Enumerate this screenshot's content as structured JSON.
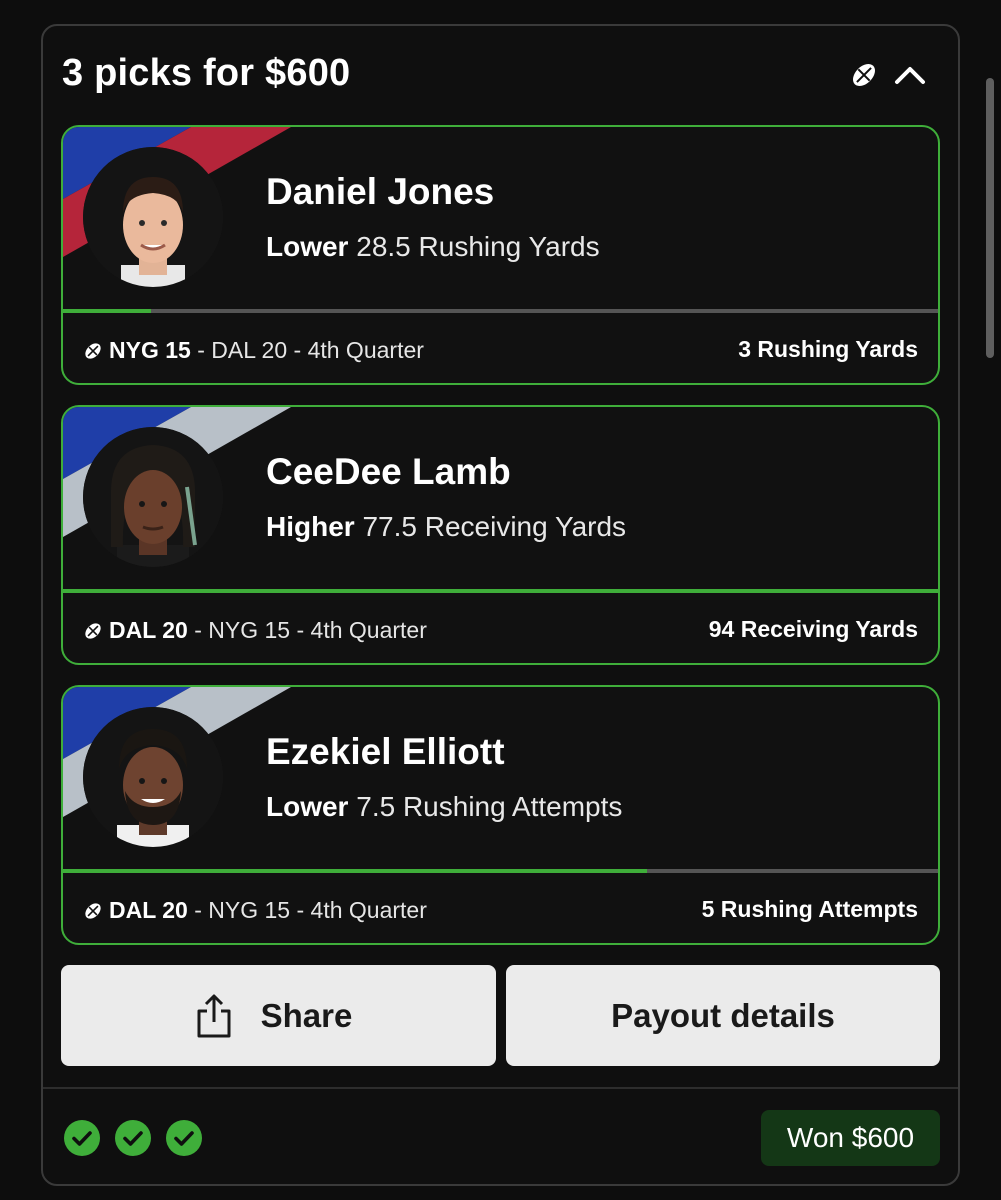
{
  "entry": {
    "title": "3 picks for $600"
  },
  "colors": {
    "accent_green": "#3fae3a",
    "badge_bg": "#143716",
    "stripe_blue": "#1f3ea8",
    "stripe_red": "#b5253a",
    "stripe_silver": "#b8c0c8"
  },
  "picks": [
    {
      "player": "Daniel Jones",
      "direction": "Lower",
      "line": "28.5 Rushing Yards",
      "team_score": "NYG 15",
      "rest_of_score": "- DAL 20 - 4th Quarter",
      "result": "3 Rushing Yards",
      "progress_fraction": 0.1
    },
    {
      "player": "CeeDee Lamb",
      "direction": "Higher",
      "line": "77.5 Receiving Yards",
      "team_score": "DAL 20",
      "rest_of_score": "- NYG 15 - 4th Quarter",
      "result": "94 Receiving Yards",
      "progress_fraction": 1.0
    },
    {
      "player": "Ezekiel Elliott",
      "direction": "Lower",
      "line": "7.5 Rushing Attempts",
      "team_score": "DAL 20",
      "rest_of_score": "- NYG 15 - 4th Quarter",
      "result": "5 Rushing Attempts",
      "progress_fraction": 0.667
    }
  ],
  "actions": {
    "share_label": "Share",
    "payout_label": "Payout details"
  },
  "footer": {
    "checks": 3,
    "status": "Won $600"
  }
}
